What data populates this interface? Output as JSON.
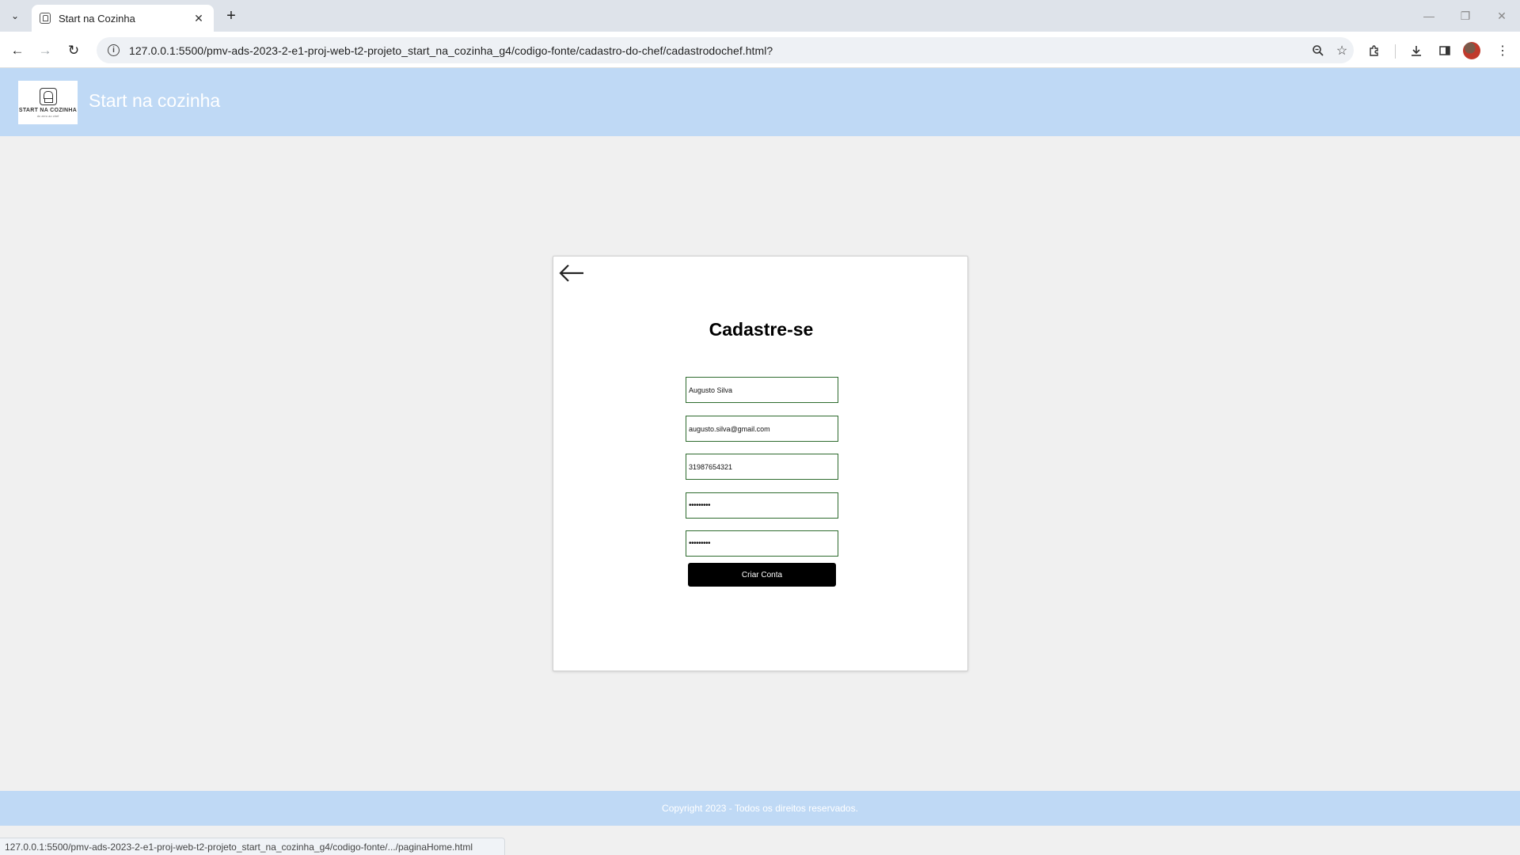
{
  "browser": {
    "tab_title": "Start na Cozinha",
    "url": "127.0.0.1:5500/pmv-ads-2023-2-e1-proj-web-t2-projeto_start_na_cozinha_g4/codigo-fonte/cadastro-do-chef/cadastrodochef.html?",
    "status_url": "127.0.0.1:5500/pmv-ads-2023-2-e1-proj-web-t2-projeto_start_na_cozinha_g4/codigo-fonte/.../paginaHome.html"
  },
  "header": {
    "title": "Start na cozinha",
    "logo_text": "START NA COZINHA",
    "logo_subtext": "do zero ao chef"
  },
  "form": {
    "title": "Cadastre-se",
    "name_value": "Augusto Silva",
    "email_value": "augusto.silva@gmail.com",
    "phone_value": "31987654321",
    "password_value": "•••••••••",
    "confirm_password_value": "•••••••••",
    "submit_label": "Criar Conta"
  },
  "footer": {
    "text": "Copyright 2023 - Todos os direitos reservados."
  },
  "colors": {
    "header_bg": "#bfd9f5",
    "page_bg": "#f0f0f0",
    "field_border": "#2e6b2e",
    "button_bg": "#000000"
  }
}
